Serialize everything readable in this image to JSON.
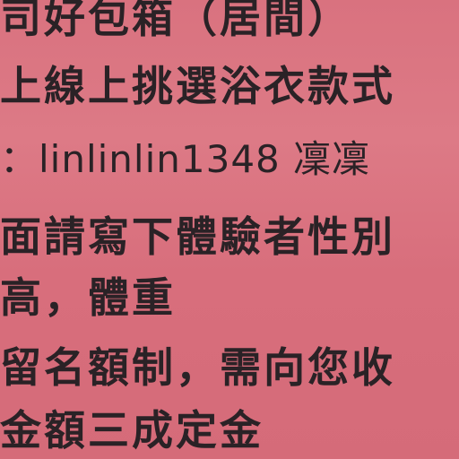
{
  "lines": [
    "司好包箱（居間）",
    "上線上挑選浴衣款式",
    "：linlinlin1348 凜凜",
    "面請寫下體驗者性別",
    "高，體重",
    "留名額制，需向您收",
    "金額三成定金"
  ],
  "colors": {
    "background": "#d9727f",
    "text": "#2a2226"
  }
}
